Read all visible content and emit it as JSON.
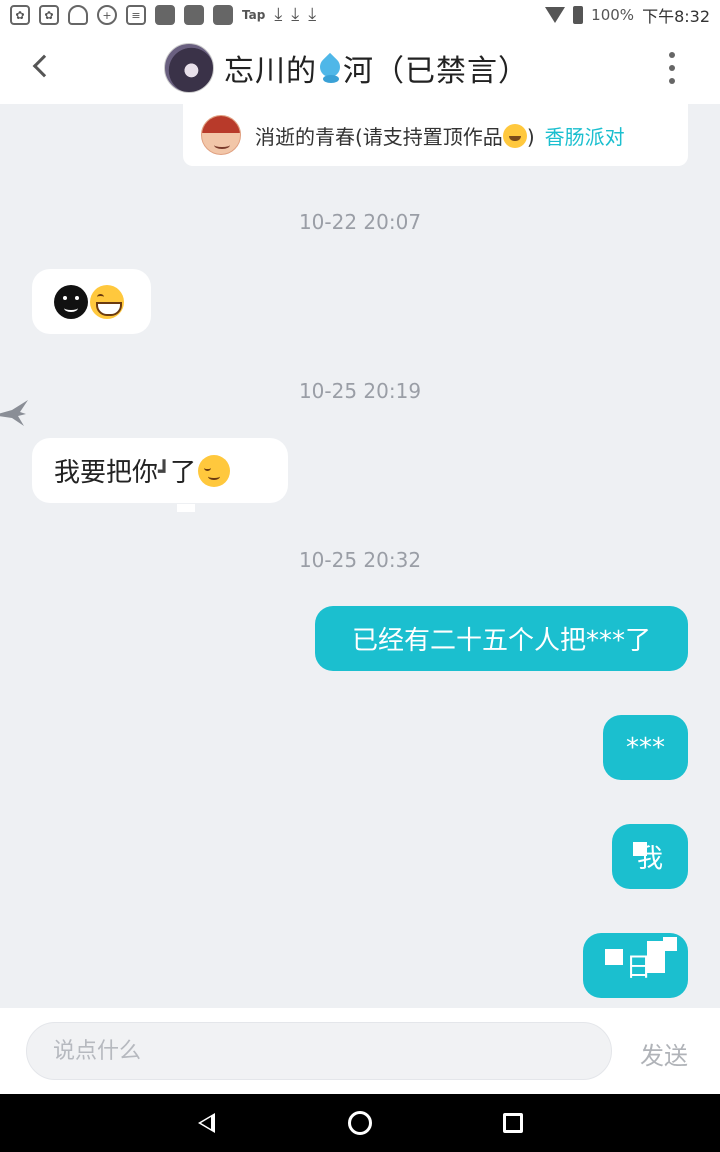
{
  "status_bar": {
    "app_icons": [
      "paw-icon",
      "paw-icon",
      "cloud-icon",
      "plus-circle-icon",
      "document-icon",
      "image-icon",
      "app-icon",
      "app-icon"
    ],
    "tap_label": "Tap",
    "download_icons": [
      "download-icon",
      "download-icon",
      "download-icon"
    ],
    "battery_text": "100%",
    "time": "下午8:32"
  },
  "header": {
    "title_part1": "忘川的",
    "title_part2": "河（已禁言）",
    "title_icon": "water-drop-icon"
  },
  "pinned": {
    "text": "消逝的青春(请支持置顶作品",
    "text_end": ")",
    "link": "香肠派对"
  },
  "messages": [
    {
      "timestamp": "10-22 20:07"
    },
    {
      "timestamp": "10-25 20:19",
      "text": "我要把你",
      "glitch": "┛",
      "text_after": "了"
    },
    {
      "timestamp": "10-25 20:32"
    }
  ],
  "outgoing": {
    "msg1": "已经有二十五个人把***了",
    "msg2": "***",
    "msg3": "我",
    "msg4": "日"
  },
  "input": {
    "placeholder": "说点什么",
    "send_label": "发送"
  },
  "colors": {
    "accent": "#1bbfcf",
    "chat_bg": "#eef0f3"
  }
}
